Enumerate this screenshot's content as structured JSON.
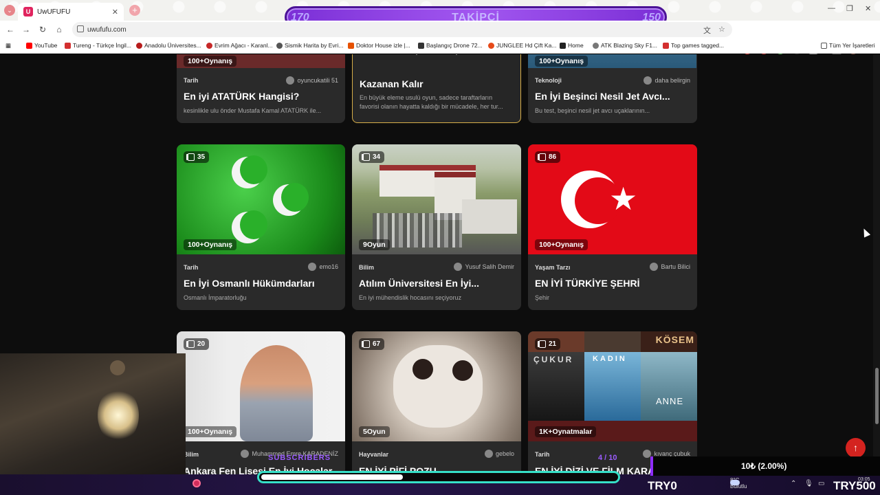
{
  "browser": {
    "tab_title": "UwUFUFU",
    "tab_favicon": "U",
    "url": "uwufufu.com",
    "bookmarks": [
      {
        "label": "YouTube",
        "color": "#ff0000"
      },
      {
        "label": "Tureng - Türkçe İngil...",
        "color": "#d32f2f"
      },
      {
        "label": "Anadolu Üniversites...",
        "color": "#b71c1c"
      },
      {
        "label": "Evrim Ağacı - Karanl...",
        "color": "#c62828"
      },
      {
        "label": "Sismik Harita by Evri...",
        "color": "#555555"
      },
      {
        "label": "Doktor House izle |...",
        "color": "#e65100"
      },
      {
        "label": "Başlangıç Drone 72...",
        "color": "#333333"
      },
      {
        "label": "JUNGLEE Hd Çift Ka...",
        "color": "#e64a19"
      },
      {
        "label": "Home",
        "color": "#222222"
      },
      {
        "label": "ATK Blazing Sky F1...",
        "color": "#777777"
      },
      {
        "label": "Top games tagged...",
        "color": "#d32f2f"
      }
    ],
    "bookmarks_all": "Tüm Yer İşaretleri"
  },
  "follow_goal": {
    "current": "170",
    "label": "TAKİPÇİ",
    "target": "150"
  },
  "top_cards": [
    {
      "plays": "100+Oynanış",
      "category": "Tarih",
      "author": "oyuncukatili 51",
      "title": "En iyi ATATÜRK Hangisi?",
      "desc": "kesinlikle ulu önder Mustafa Kamal ATATÜRK ile..."
    },
    {
      "category": "",
      "author": "",
      "title": "Kazanan Kalır",
      "desc_line1": "En büyük eleme usulü oyun, sadece taraftarların",
      "desc_line2": "favorisi olanın hayatta kaldığı bir mücadele, her tur..."
    },
    {
      "plays": "100+Oynanış",
      "category": "Teknoloji",
      "author": "daha belirgin",
      "title": "En İyi Beşinci Nesil Jet Avcı...",
      "desc": "Bu test, beşinci nesil jet avcı uçaklarının..."
    }
  ],
  "middle_cards": [
    {
      "count": "35",
      "plays": "100+Oynanış",
      "category": "Tarih",
      "author": "emo16",
      "title": "En İyi Osmanlı Hükümdarları",
      "desc": "Osmanlı İmparatorluğu"
    },
    {
      "count": "34",
      "plays": "9Oyun",
      "category": "Bilim",
      "author": "Yusuf Salih Demir",
      "title": "Atılım Üniversitesi En İyi...",
      "desc": "En iyi mühendislik hocasını seçiyoruz"
    },
    {
      "count": "86",
      "plays": "100+Oynanış",
      "category": "Yaşam Tarzı",
      "author": "Bartu Bilici",
      "title": "EN İYİ TÜRKİYE ŞEHRİ",
      "desc": "Şehir"
    }
  ],
  "bottom_cards": [
    {
      "count": "20",
      "plays": "100+Oynanış",
      "category": "Bilim",
      "author": "Muhammed Emre KARADENİZ",
      "title": "Ankara Fen Lisesi En İyi Hocalar"
    },
    {
      "count": "67",
      "plays": "5Oyun",
      "category": "Hayvanlar",
      "author": "gebelo",
      "title": "EN İYİ PİFİ POZU"
    },
    {
      "count": "21",
      "plays": "1K+Oynatmalar",
      "category": "Tarih",
      "author": "kıvanç çubuk",
      "title": "EN İYİ DİZİ VE FİLM KARA"
    }
  ],
  "drama_posters": [
    "ÇUKUR",
    "KADIN",
    "KÖSEM",
    "ANNE"
  ],
  "stream": {
    "subs_label": "SUBSCRIBERS",
    "subs_count": "4 / 10",
    "progress_fraction": 0.4,
    "donation": "10₺ (2.00%)",
    "try_start": "TRY0",
    "try_goal": "TRY500",
    "weather_temp": "8°C",
    "weather_desc": "Bulutlu",
    "clock": "03:05"
  }
}
